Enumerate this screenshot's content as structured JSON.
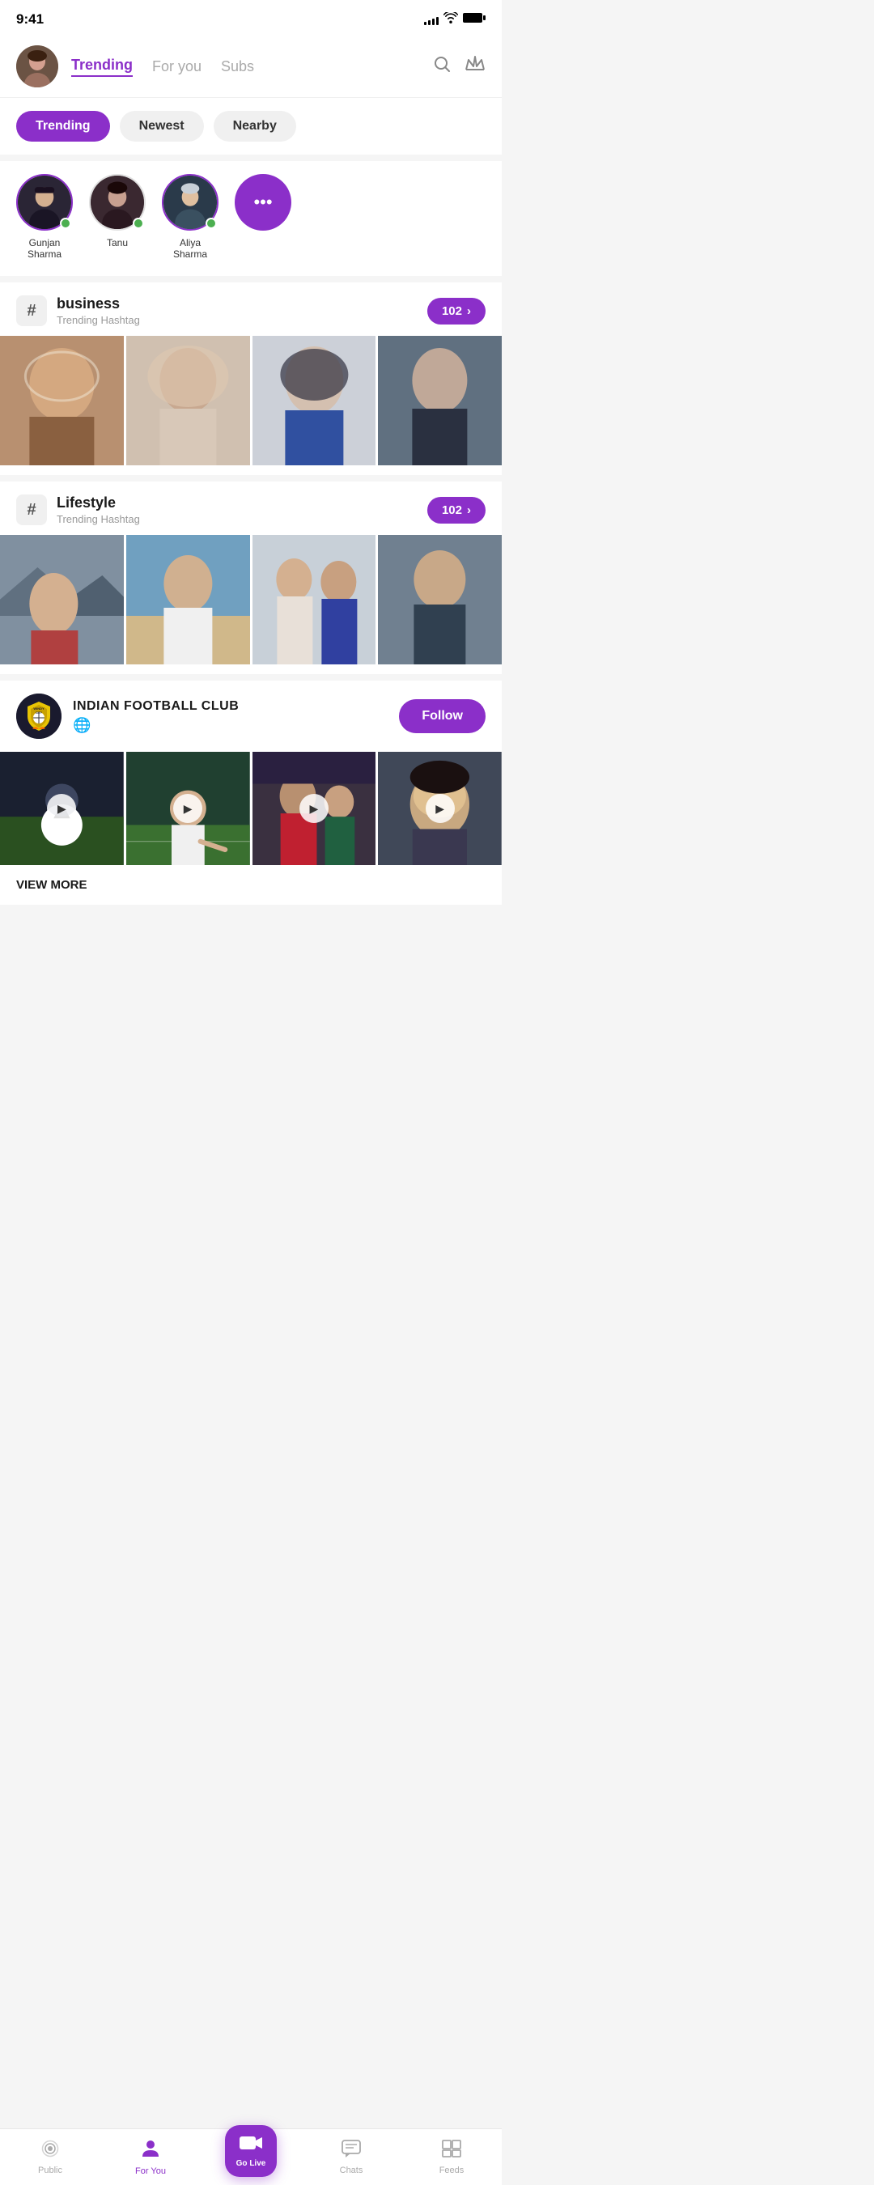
{
  "statusBar": {
    "time": "9:41",
    "signalBars": [
      4,
      6,
      8,
      10,
      12
    ],
    "batteryFull": true
  },
  "header": {
    "tabs": [
      {
        "label": "Trending",
        "active": true
      },
      {
        "label": "For you",
        "active": false
      },
      {
        "label": "Subs",
        "active": false
      }
    ],
    "searchIconLabel": "search-icon",
    "crownIconLabel": "crown-icon"
  },
  "filterPills": [
    {
      "label": "Trending",
      "active": true
    },
    {
      "label": "Newest",
      "active": false
    },
    {
      "label": "Nearby",
      "active": false
    }
  ],
  "stories": [
    {
      "name": "Gunjan Sharma",
      "online": true,
      "hasRing": true
    },
    {
      "name": "Tanu",
      "online": true,
      "hasRing": false
    },
    {
      "name": "Aliya Sharma",
      "online": true,
      "hasRing": true
    },
    {
      "name": "more",
      "isMore": true
    }
  ],
  "hashtagCards": [
    {
      "tag": "business",
      "subtitle": "Trending Hashtag",
      "count": "102"
    },
    {
      "tag": "Lifestyle",
      "subtitle": "Trending Hashtag",
      "count": "102"
    }
  ],
  "clubCard": {
    "name": "INDIAN FOOTBALL CLUB",
    "logoText": "WINDY city",
    "followLabel": "Follow",
    "viewMoreLabel": "VIEW MORE"
  },
  "bottomNav": [
    {
      "label": "Public",
      "icon": "radio-icon",
      "active": false
    },
    {
      "label": "For You",
      "icon": "person-icon",
      "active": true
    },
    {
      "label": "Go Live",
      "icon": "camera-icon",
      "isCenter": true
    },
    {
      "label": "Chats",
      "icon": "chat-icon",
      "active": false
    },
    {
      "label": "Feeds",
      "icon": "feeds-icon",
      "active": false
    }
  ]
}
